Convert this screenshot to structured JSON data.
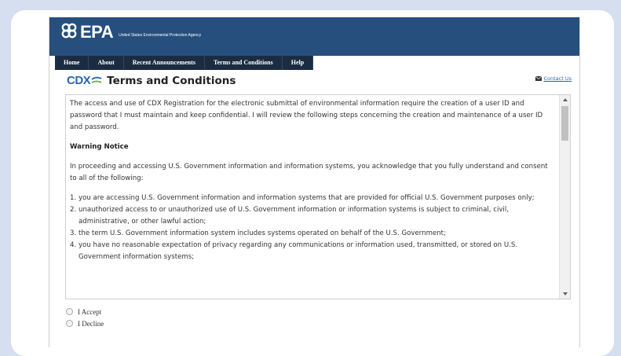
{
  "header": {
    "logo_text": "EPA",
    "agency_name": "United States Environmental Protection Agency"
  },
  "nav": {
    "items": [
      {
        "label": "Home"
      },
      {
        "label": "About"
      },
      {
        "label": "Recent Announcements"
      },
      {
        "label": "Terms and Conditions"
      },
      {
        "label": "Help"
      }
    ]
  },
  "page": {
    "logo_text": "CDX",
    "title": "Terms and Conditions",
    "contact_link": "Contact Us"
  },
  "terms": {
    "intro": "The access and use of CDX Registration for the electronic submittal of environmental information require the creation of a user ID and password that I must maintain and keep confidential. I will review the following steps concerning the creation and maintenance of a user ID and password.",
    "warning_heading": "Warning Notice",
    "consent_paragraph": "In proceeding and accessing U.S. Government information and information systems, you acknowledge that you fully understand and consent to all of the following:",
    "list": [
      {
        "num": "1.",
        "text": "you are accessing U.S. Government information and information systems that are provided for official U.S. Government purposes only;"
      },
      {
        "num": "2.",
        "text": "unauthorized access to or unauthorized use of U.S. Government information or information systems is subject to criminal, civil, administrative, or other lawful action;"
      },
      {
        "num": "3.",
        "text": "the term U.S. Government information system includes systems operated on behalf of the U.S. Government;"
      },
      {
        "num": "4.",
        "text": "you have no reasonable expectation of privacy regarding any communications or information used, transmitted, or stored on U.S. Government information systems;"
      }
    ]
  },
  "options": {
    "accept": "I Accept",
    "decline": "I Decline",
    "selected": "none"
  },
  "colors": {
    "header_bg": "#264f7d",
    "nav_bg": "#1b2c42",
    "link": "#2a64b0",
    "page_bg": "#d6dff0"
  }
}
